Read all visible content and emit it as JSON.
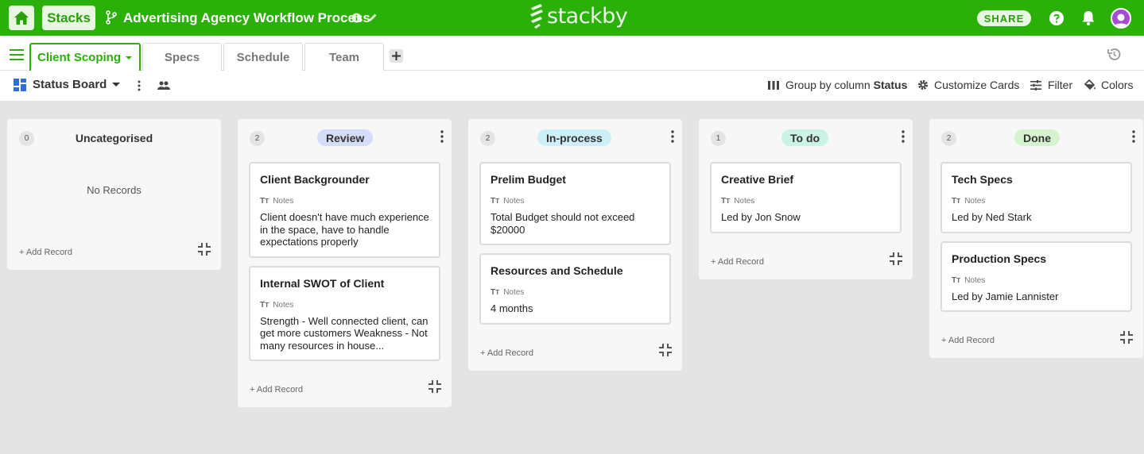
{
  "header": {
    "stacks_label": "Stacks",
    "stack_title": "Advertising Agency Workflow Process",
    "logo_text": "stackby",
    "share_label": "SHARE",
    "brand_color": "#2bb00a"
  },
  "tabs": [
    {
      "label": "Client Scoping",
      "active": true
    },
    {
      "label": "Specs",
      "active": false
    },
    {
      "label": "Schedule",
      "active": false
    },
    {
      "label": "Team",
      "active": false
    }
  ],
  "toolbar": {
    "view_name": "Status Board",
    "group_by_prefix": "Group by column",
    "group_by_field": "Status",
    "customize_label": "Customize Cards",
    "filter_label": "Filter",
    "colors_label": "Colors"
  },
  "board": {
    "no_records_text": "No Records",
    "add_record_label": "+ Add Record",
    "field_label": "Notes",
    "columns": [
      {
        "title": "Uncategorised",
        "count": "0",
        "badge_color": null,
        "cards": []
      },
      {
        "title": "Review",
        "count": "2",
        "badge_color": "#d3ddf7",
        "cards": [
          {
            "title": "Client Backgrounder",
            "notes": "Client doesn't have much experience in the space, have to handle expectations properly"
          },
          {
            "title": "Internal SWOT of Client",
            "notes": "Strength - Well connected client, can get more customers Weakness - Not many resources in house..."
          }
        ]
      },
      {
        "title": "In-process",
        "count": "2",
        "badge_color": "#cdeffa",
        "cards": [
          {
            "title": "Prelim Budget",
            "notes": "Total Budget should not exceed $20000"
          },
          {
            "title": "Resources and Schedule",
            "notes": "4 months"
          }
        ]
      },
      {
        "title": "To do",
        "count": "1",
        "badge_color": "#c9f3e4",
        "cards": [
          {
            "title": "Creative Brief",
            "notes": "Led by Jon Snow"
          }
        ]
      },
      {
        "title": "Done",
        "count": "2",
        "badge_color": "#d5f3cf",
        "cards": [
          {
            "title": "Tech Specs",
            "notes": "Led by Ned Stark"
          },
          {
            "title": "Production Specs",
            "notes": "Led by Jamie Lannister"
          }
        ]
      }
    ]
  }
}
